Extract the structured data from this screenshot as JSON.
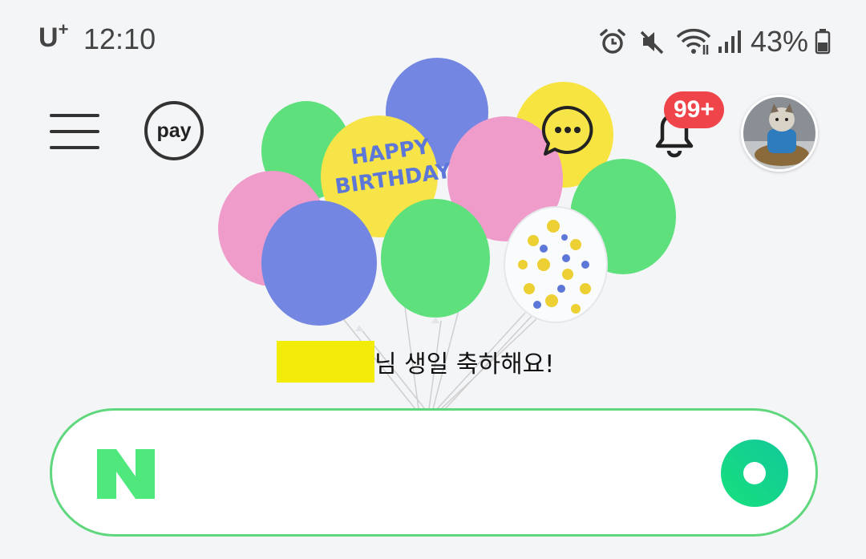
{
  "status_bar": {
    "carrier": "U",
    "carrier_sup": "+",
    "time": "12:10",
    "battery": "43%",
    "icons": [
      "alarm-icon",
      "mute-icon",
      "wifi-icon",
      "signal-icon",
      "battery-icon"
    ]
  },
  "nav": {
    "menu_icon": "hamburger-menu-icon",
    "pay_label": "pay",
    "chat_icon": "chat-bubble-icon",
    "notification_icon": "bell-icon",
    "notification_count": "99+",
    "avatar": "profile-avatar-cat"
  },
  "birthday": {
    "message": "님 생일 축하해요!",
    "balloon_text_line1": "HAPPY",
    "balloon_text_line2": "BIRTHDAY"
  },
  "search": {
    "logo_letter": "N",
    "value": "",
    "placeholder": "",
    "button_icon": "green-search-circle-icon"
  },
  "colors": {
    "accent_green": "#5fd77d",
    "naver_green": "#03c75a",
    "badge_red": "#f0444b",
    "redaction_yellow": "#f3ec0a"
  }
}
